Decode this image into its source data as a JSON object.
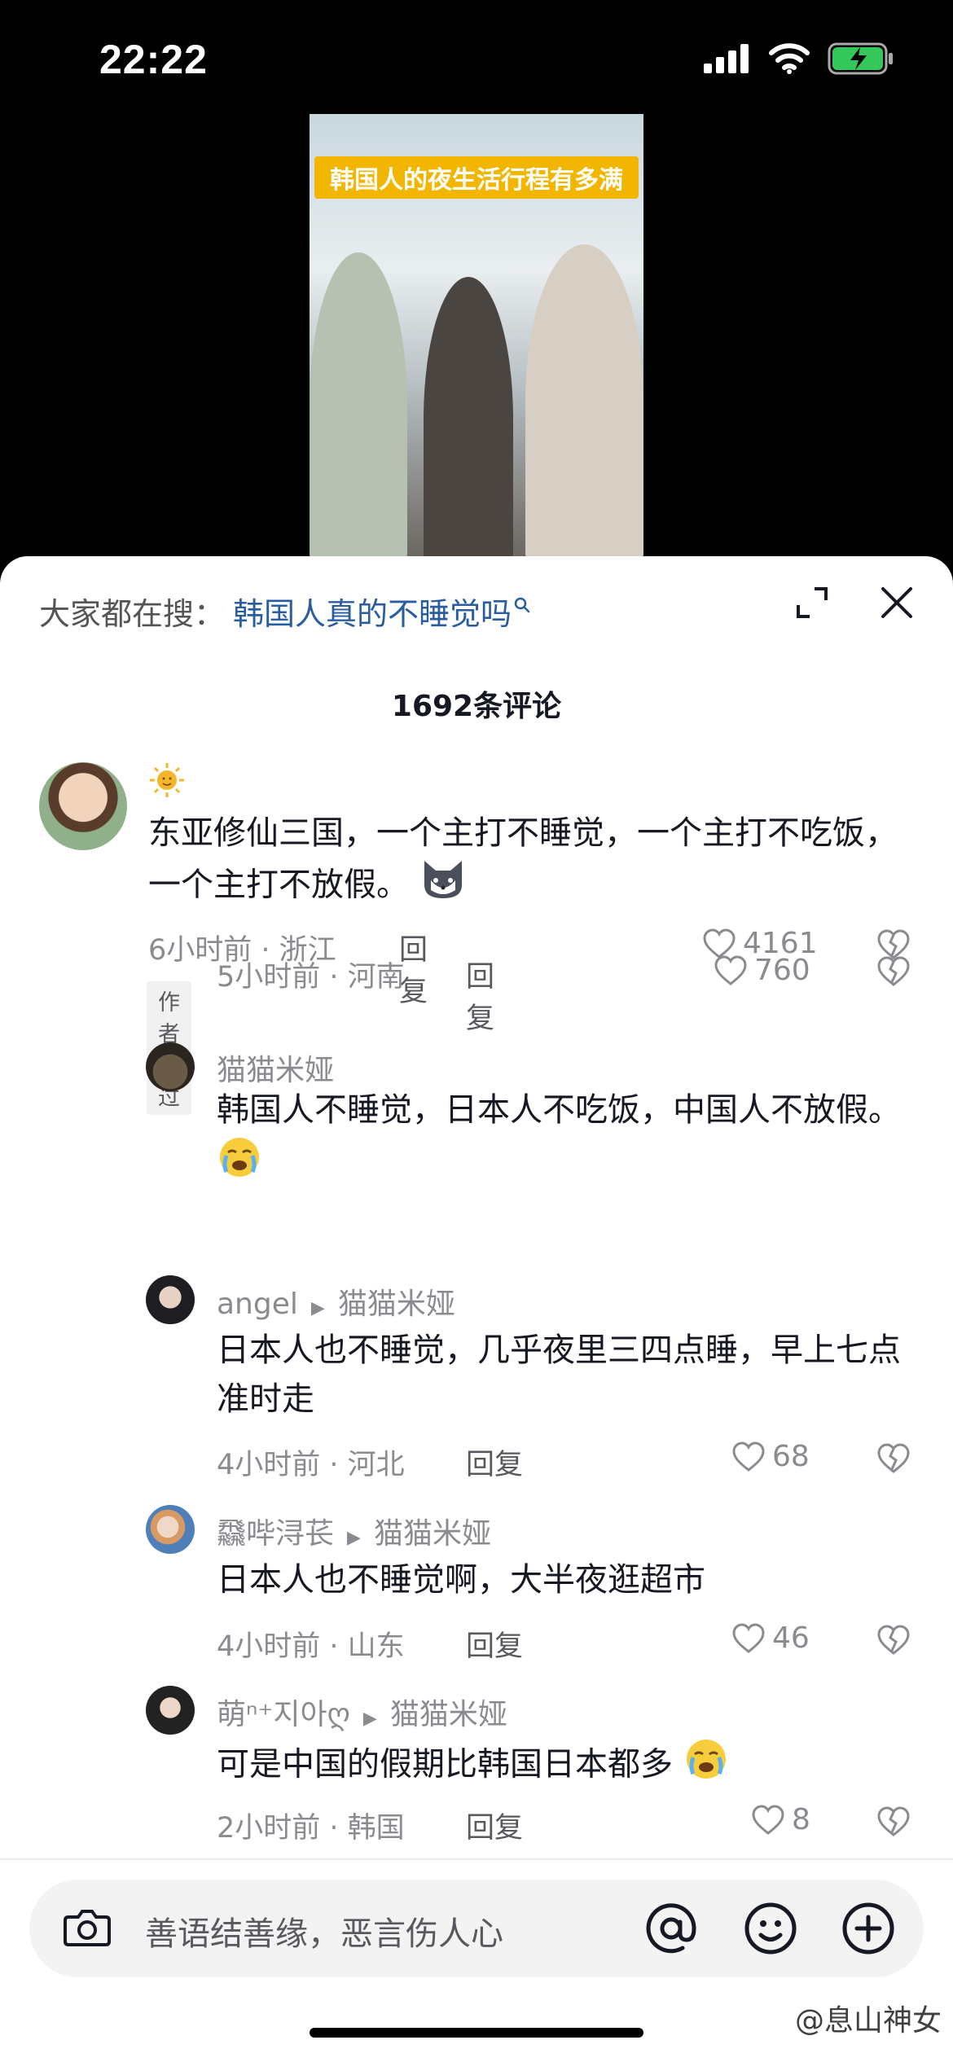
{
  "status": {
    "time": "22:22"
  },
  "video": {
    "caption": "韩国人的夜生活行程有多满"
  },
  "search": {
    "prefix": "大家都在搜：",
    "query": "韩国人真的不睡觉吗"
  },
  "comments_count": "1692条评论",
  "comments": [
    {
      "name": "",
      "text": "东亚修仙三国，一个主打不睡觉，一个主打不吃饭，一个主打不放假。",
      "time": "6小时前 · 浙江",
      "reply": "回复",
      "likes": "4161",
      "badge": "作者赞过"
    },
    {
      "name": "猫猫米娅",
      "text": "韩国人不睡觉，日本人不吃饭，中国人不放假。",
      "time": "5小时前 · 河南",
      "reply": "回复",
      "likes": "760"
    },
    {
      "name": "angel",
      "reply_to": "猫猫米娅",
      "text": "日本人也不睡觉，几乎夜里三四点睡，早上七点准时走",
      "time": "4小时前 · 河北",
      "reply": "回复",
      "likes": "68"
    },
    {
      "name": "飝哔浔苌",
      "reply_to": "猫猫米娅",
      "text": "日本人也不睡觉啊，大半夜逛超市",
      "time": "4小时前 · 山东",
      "reply": "回复",
      "likes": "46"
    },
    {
      "name": "萌ⁿ⁺지아ღ",
      "reply_to": "猫猫米娅",
      "text": "可是中国的假期比韩国日本都多",
      "time": "2小时前 · 韩国",
      "reply": "回复",
      "likes": "8"
    }
  ],
  "input": {
    "placeholder": "善语结善缘，恶言伤人心"
  },
  "watermark": "@息山神女",
  "icons": [
    "signal-icon",
    "wifi-icon",
    "battery-charging-icon",
    "expand-icon",
    "close-icon",
    "heart-icon",
    "broken-heart-icon",
    "camera-icon",
    "at-icon",
    "emoji-icon",
    "plus-icon",
    "sun-emoji",
    "cat-emoji",
    "crying-emoji"
  ]
}
